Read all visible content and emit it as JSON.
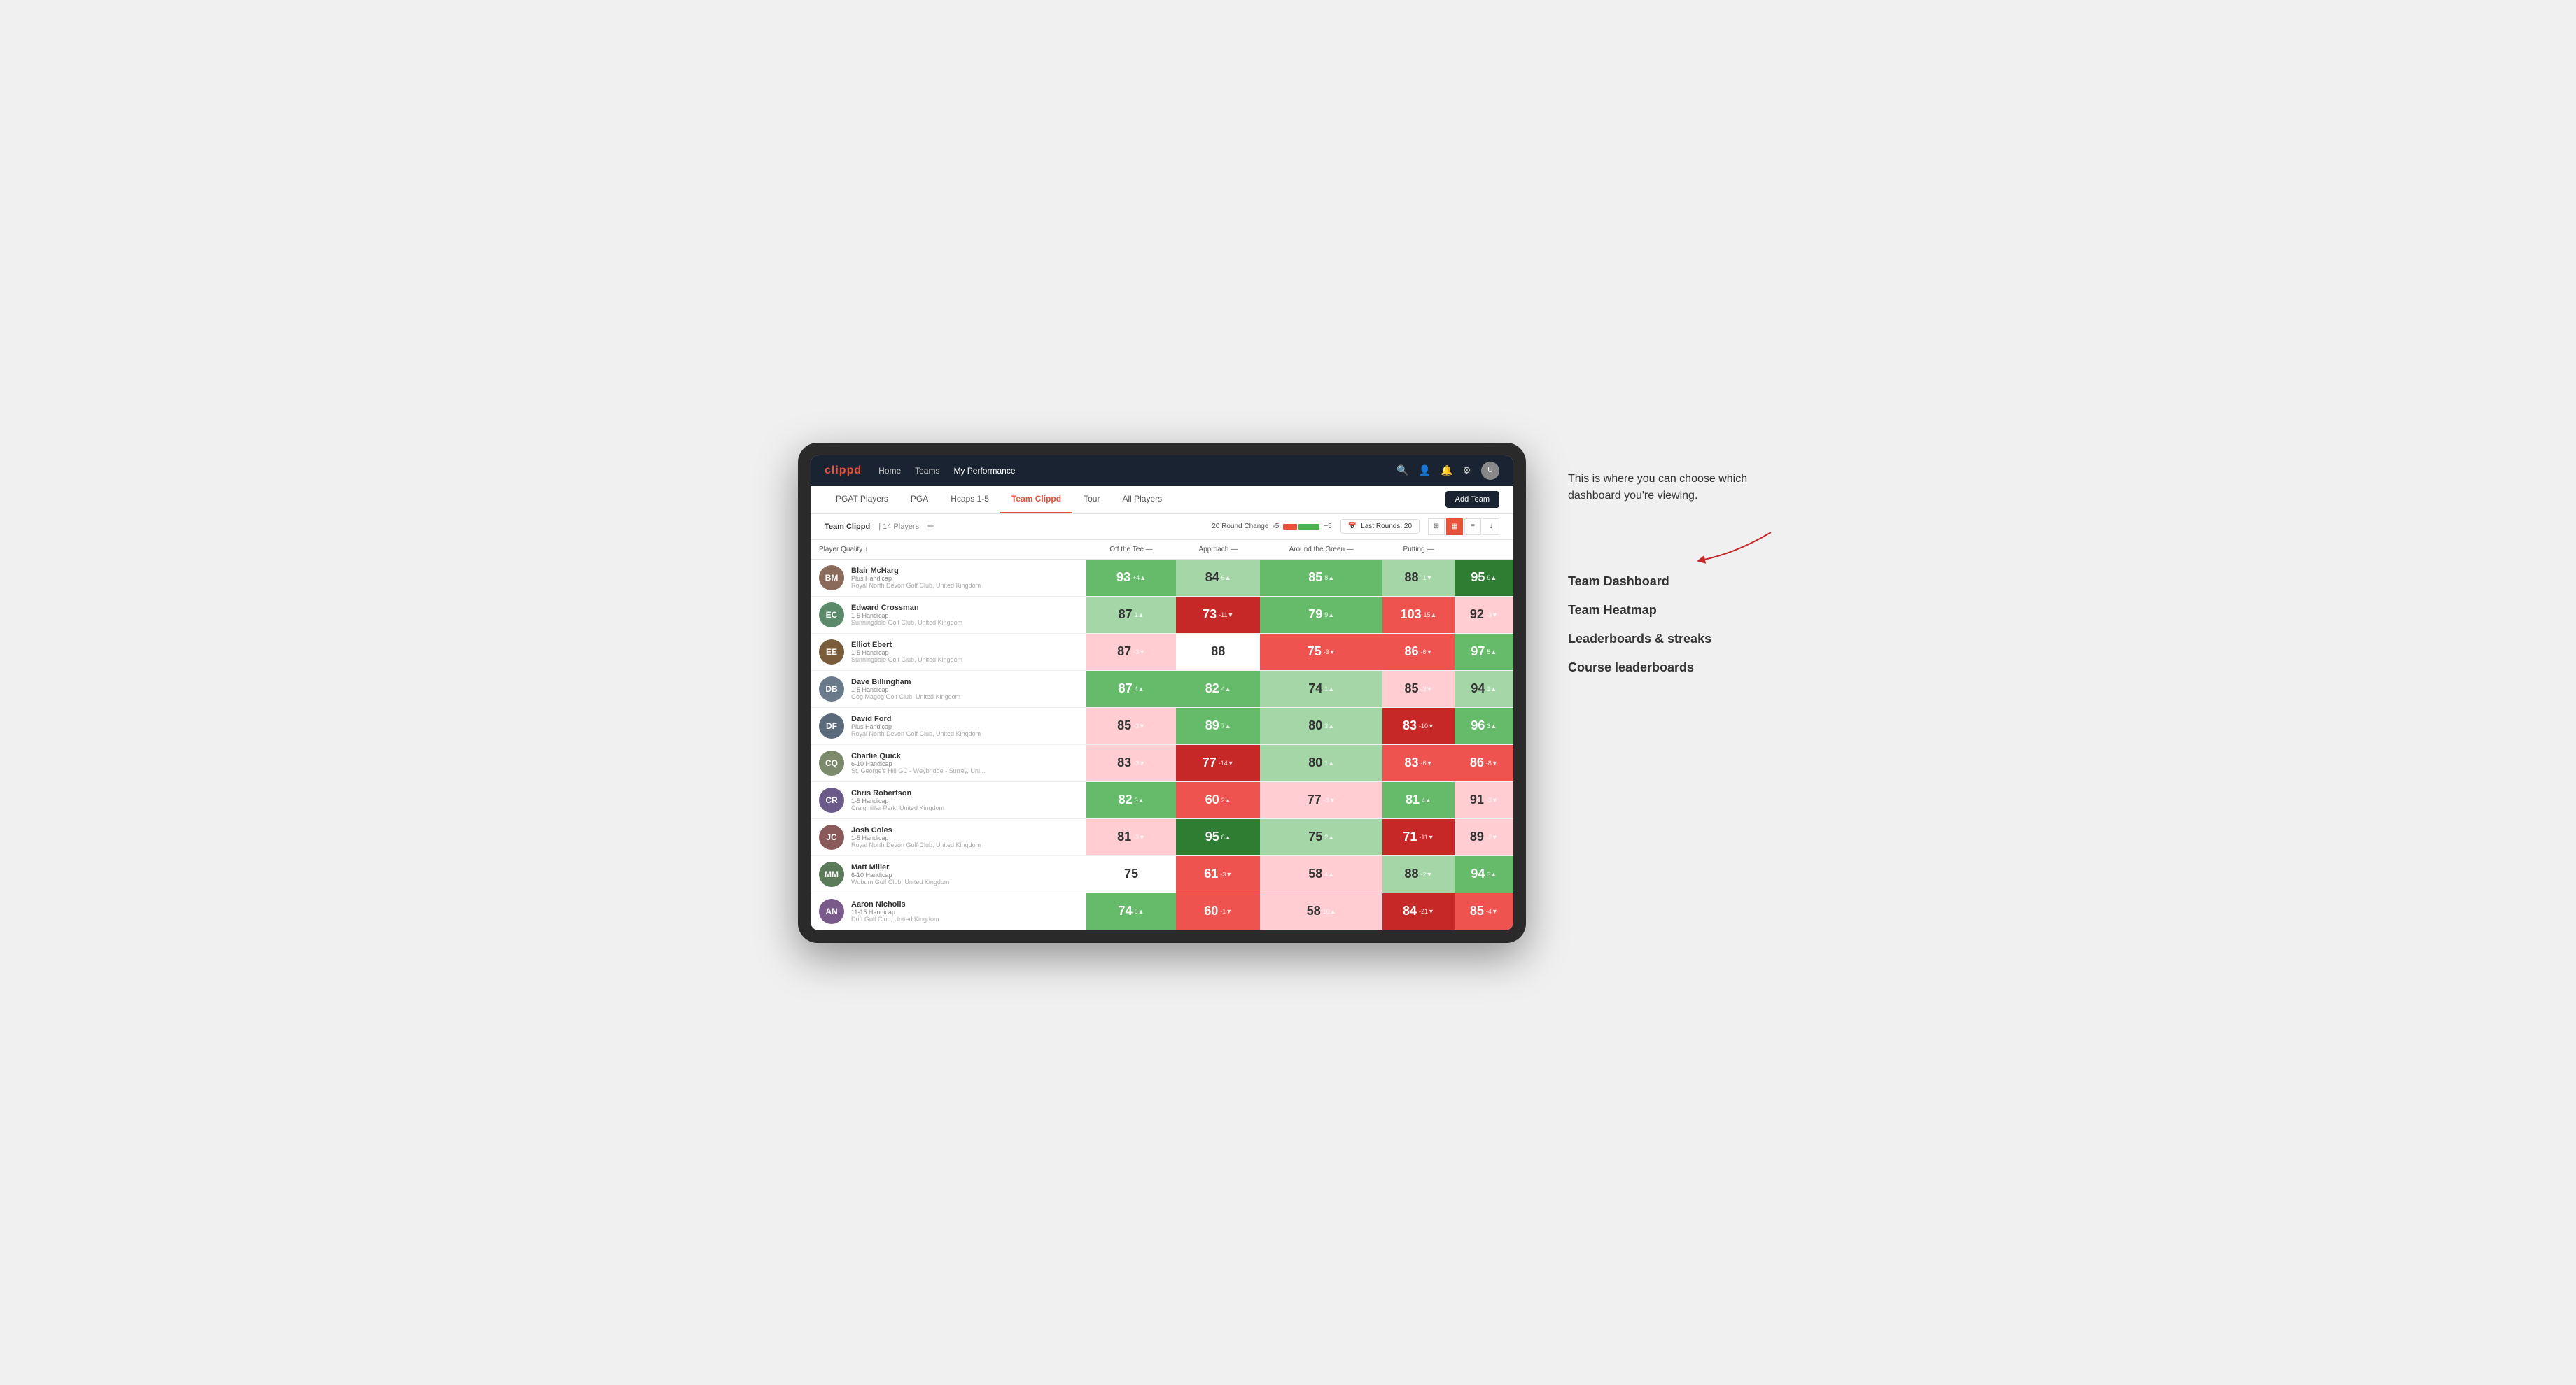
{
  "annotation": {
    "callout": "This is where you can choose which dashboard you're viewing.",
    "items": [
      "Team Dashboard",
      "Team Heatmap",
      "Leaderboards & streaks",
      "Course leaderboards"
    ]
  },
  "nav": {
    "logo": "clippd",
    "links": [
      {
        "label": "Home",
        "active": false
      },
      {
        "label": "Teams",
        "active": false
      },
      {
        "label": "My Performance",
        "active": true
      }
    ],
    "add_team_label": "Add Team"
  },
  "tabs": [
    {
      "label": "PGAT Players",
      "active": false
    },
    {
      "label": "PGA",
      "active": false
    },
    {
      "label": "Hcaps 1-5",
      "active": false
    },
    {
      "label": "Team Clippd",
      "active": true
    },
    {
      "label": "Tour",
      "active": false
    },
    {
      "label": "All Players",
      "active": false
    }
  ],
  "team_bar": {
    "name": "Team Clippd",
    "player_count": "14 Players",
    "round_change_label": "20 Round Change",
    "minus_label": "-5",
    "plus_label": "+5",
    "last_rounds_label": "Last Rounds: 20"
  },
  "table": {
    "headers": {
      "player": "Player Quality ↓",
      "off_tee": "Off the Tee —",
      "approach": "Approach —",
      "around_green": "Around the Green —",
      "putting": "Putting —"
    },
    "players": [
      {
        "name": "Blair McHarg",
        "handicap": "Plus Handicap",
        "club": "Royal North Devon Golf Club, United Kingdom",
        "avatar_color": "#7a5c3a",
        "initials": "BM",
        "quality": {
          "value": 93,
          "change": "+4",
          "dir": "up",
          "bg": "bg-green"
        },
        "off_tee": {
          "value": 84,
          "change": "6",
          "dir": "up",
          "bg": "bg-green-light"
        },
        "approach": {
          "value": 85,
          "change": "8",
          "dir": "up",
          "bg": "bg-green"
        },
        "around_green": {
          "value": 88,
          "change": "-1",
          "dir": "down",
          "bg": "bg-green-light"
        },
        "putting": {
          "value": 95,
          "change": "9",
          "dir": "up",
          "bg": "bg-green-dark"
        }
      },
      {
        "name": "Edward Crossman",
        "handicap": "1-5 Handicap",
        "club": "Sunningdale Golf Club, United Kingdom",
        "avatar_color": "#5a8a6a",
        "initials": "EC",
        "quality": {
          "value": 87,
          "change": "1",
          "dir": "up",
          "bg": "bg-green-light"
        },
        "off_tee": {
          "value": 73,
          "change": "-11",
          "dir": "down",
          "bg": "bg-red-dark"
        },
        "approach": {
          "value": 79,
          "change": "9",
          "dir": "up",
          "bg": "bg-green"
        },
        "around_green": {
          "value": 103,
          "change": "15",
          "dir": "up",
          "bg": "bg-red"
        },
        "putting": {
          "value": 92,
          "change": "-3",
          "dir": "down",
          "bg": "bg-red-light"
        }
      },
      {
        "name": "Elliot Ebert",
        "handicap": "1-5 Handicap",
        "club": "Sunningdale Golf Club, United Kingdom",
        "avatar_color": "#8a6a5a",
        "initials": "EE",
        "quality": {
          "value": 87,
          "change": "-3",
          "dir": "down",
          "bg": "bg-red-light"
        },
        "off_tee": {
          "value": 88,
          "change": "",
          "dir": "",
          "bg": "bg-white"
        },
        "approach": {
          "value": 75,
          "change": "-3",
          "dir": "down",
          "bg": "bg-red"
        },
        "around_green": {
          "value": 86,
          "change": "-6",
          "dir": "down",
          "bg": "bg-red"
        },
        "putting": {
          "value": 97,
          "change": "5",
          "dir": "up",
          "bg": "bg-green"
        }
      },
      {
        "name": "Dave Billingham",
        "handicap": "1-5 Handicap",
        "club": "Gog Magog Golf Club, United Kingdom",
        "avatar_color": "#6a7a8a",
        "initials": "DB",
        "quality": {
          "value": 87,
          "change": "4",
          "dir": "up",
          "bg": "bg-green"
        },
        "off_tee": {
          "value": 82,
          "change": "4",
          "dir": "up",
          "bg": "bg-green"
        },
        "approach": {
          "value": 74,
          "change": "1",
          "dir": "up",
          "bg": "bg-green-light"
        },
        "around_green": {
          "value": 85,
          "change": "-3",
          "dir": "down",
          "bg": "bg-red-light"
        },
        "putting": {
          "value": 94,
          "change": "1",
          "dir": "up",
          "bg": "bg-green-light"
        }
      },
      {
        "name": "David Ford",
        "handicap": "Plus Handicap",
        "club": "Royal North Devon Golf Club, United Kingdom",
        "avatar_color": "#5a6a7a",
        "initials": "DF",
        "quality": {
          "value": 85,
          "change": "-3",
          "dir": "down",
          "bg": "bg-red-light"
        },
        "off_tee": {
          "value": 89,
          "change": "7",
          "dir": "up",
          "bg": "bg-green"
        },
        "approach": {
          "value": 80,
          "change": "3",
          "dir": "up",
          "bg": "bg-green-light"
        },
        "around_green": {
          "value": 83,
          "change": "-10",
          "dir": "down",
          "bg": "bg-red-dark"
        },
        "putting": {
          "value": 96,
          "change": "3",
          "dir": "up",
          "bg": "bg-green"
        }
      },
      {
        "name": "Charlie Quick",
        "handicap": "6-10 Handicap",
        "club": "St. George's Hill GC - Weybridge - Surrey, Uni...",
        "avatar_color": "#7a8a6a",
        "initials": "CQ",
        "quality": {
          "value": 83,
          "change": "-3",
          "dir": "down",
          "bg": "bg-red-light"
        },
        "off_tee": {
          "value": 77,
          "change": "-14",
          "dir": "down",
          "bg": "bg-red-dark"
        },
        "approach": {
          "value": 80,
          "change": "1",
          "dir": "up",
          "bg": "bg-green-light"
        },
        "around_green": {
          "value": 83,
          "change": "-6",
          "dir": "down",
          "bg": "bg-red"
        },
        "putting": {
          "value": 86,
          "change": "-8",
          "dir": "down",
          "bg": "bg-red"
        }
      },
      {
        "name": "Chris Robertson",
        "handicap": "1-5 Handicap",
        "club": "Craigmillar Park, United Kingdom",
        "avatar_color": "#6a5a8a",
        "initials": "CR",
        "quality": {
          "value": 82,
          "change": "3",
          "dir": "up",
          "bg": "bg-green"
        },
        "off_tee": {
          "value": 60,
          "change": "2",
          "dir": "up",
          "bg": "bg-red"
        },
        "approach": {
          "value": 77,
          "change": "-3",
          "dir": "down",
          "bg": "bg-red-light"
        },
        "around_green": {
          "value": 81,
          "change": "4",
          "dir": "up",
          "bg": "bg-green"
        },
        "putting": {
          "value": 91,
          "change": "-3",
          "dir": "down",
          "bg": "bg-red-light"
        }
      },
      {
        "name": "Josh Coles",
        "handicap": "1-5 Handicap",
        "club": "Royal North Devon Golf Club, United Kingdom",
        "avatar_color": "#8a5a5a",
        "initials": "JC",
        "quality": {
          "value": 81,
          "change": "-3",
          "dir": "down",
          "bg": "bg-red-light"
        },
        "off_tee": {
          "value": 95,
          "change": "8",
          "dir": "up",
          "bg": "bg-green-dark"
        },
        "approach": {
          "value": 75,
          "change": "2",
          "dir": "up",
          "bg": "bg-green-light"
        },
        "around_green": {
          "value": 71,
          "change": "-11",
          "dir": "down",
          "bg": "bg-red-dark"
        },
        "putting": {
          "value": 89,
          "change": "-2",
          "dir": "down",
          "bg": "bg-red-light"
        }
      },
      {
        "name": "Matt Miller",
        "handicap": "6-10 Handicap",
        "club": "Woburn Golf Club, United Kingdom",
        "avatar_color": "#5a7a5a",
        "initials": "MM",
        "quality": {
          "value": 75,
          "change": "",
          "dir": "",
          "bg": "bg-white"
        },
        "off_tee": {
          "value": 61,
          "change": "-3",
          "dir": "down",
          "bg": "bg-red"
        },
        "approach": {
          "value": 58,
          "change": "4",
          "dir": "up",
          "bg": "bg-red-light"
        },
        "around_green": {
          "value": 88,
          "change": "-2",
          "dir": "down",
          "bg": "bg-green-light"
        },
        "putting": {
          "value": 94,
          "change": "3",
          "dir": "up",
          "bg": "bg-green"
        }
      },
      {
        "name": "Aaron Nicholls",
        "handicap": "11-15 Handicap",
        "club": "Drift Golf Club, United Kingdom",
        "avatar_color": "#7a5a8a",
        "initials": "AN",
        "quality": {
          "value": 74,
          "change": "8",
          "dir": "up",
          "bg": "bg-green"
        },
        "off_tee": {
          "value": 60,
          "change": "-1",
          "dir": "down",
          "bg": "bg-red"
        },
        "approach": {
          "value": 58,
          "change": "10",
          "dir": "up",
          "bg": "bg-red-light"
        },
        "around_green": {
          "value": 84,
          "change": "-21",
          "dir": "down",
          "bg": "bg-red-dark"
        },
        "putting": {
          "value": 85,
          "change": "-4",
          "dir": "down",
          "bg": "bg-red"
        }
      }
    ]
  }
}
